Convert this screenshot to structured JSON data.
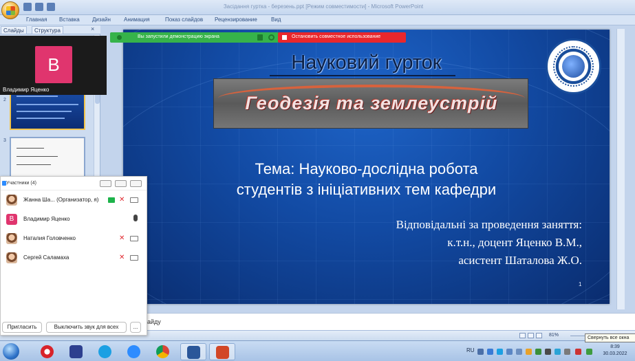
{
  "window": {
    "title": "Засідання гуртка - березень.ppt [Режим совместимости] - Microsoft PowerPoint"
  },
  "ribbon": {
    "tabs": [
      "Главная",
      "Вставка",
      "Дизайн",
      "Анимация",
      "Показ слайдов",
      "Рецензирование",
      "Вид"
    ]
  },
  "left_pane": {
    "tabs": [
      "Слайды",
      "Структура"
    ],
    "close": "×",
    "slide_numbers": [
      "2",
      "3"
    ]
  },
  "zoom": {
    "share_message": "Вы запустили демонстрацию экрана",
    "stop_share": "Остановить совместное использование",
    "video_tile": {
      "initial": "В",
      "name": "Владимир Яценко"
    },
    "participants": {
      "title": "Участники (4)",
      "people": [
        {
          "name": "Жанна Ша... (Организатор, я)",
          "avatar": "photo",
          "sharing": true,
          "mic": "muted",
          "camera": "off"
        },
        {
          "name": "Владимир Яценко",
          "avatar": "В",
          "sharing": false,
          "mic": "on",
          "camera": "none"
        },
        {
          "name": "Наталия Головченко",
          "avatar": "photo",
          "sharing": false,
          "mic": "muted",
          "camera": "off"
        },
        {
          "name": "Сергей Саламаха",
          "avatar": "photo",
          "sharing": false,
          "mic": "muted",
          "camera": "off"
        }
      ],
      "invite_button": "Пригласить",
      "mute_all_button": "Выключить звук для всех",
      "more_button": "..."
    }
  },
  "slide": {
    "title": "Науковий гурток",
    "banner": "Геодезія та землеустрій",
    "topic_line1": "Тема: Науково-дослідна робота",
    "topic_line2": "студентів з ініціативних тем кафедри",
    "resp_line1": "Відповідальні за проведення заняття:",
    "resp_line2": "к.т.н., доцент Яценко В.М.,",
    "resp_line3": "асистент Шаталова Ж.О.",
    "page_number": "1"
  },
  "notes": {
    "text": "айду"
  },
  "status": {
    "zoom_level": "81%",
    "tooltip": "Свернуть все окна"
  },
  "taskbar": {
    "language": "RU",
    "time": "8:39",
    "date": "30.03.2022",
    "apps": [
      "opera-icon",
      "save-icon",
      "skype-icon",
      "zoom-icon",
      "chrome-icon",
      "word-icon",
      "powerpoint-icon"
    ]
  },
  "colors": {
    "slide_bg": "#124aa3",
    "zoom_green": "#36b34a",
    "zoom_red": "#e9272c",
    "avatar_pink": "#e0356e"
  }
}
